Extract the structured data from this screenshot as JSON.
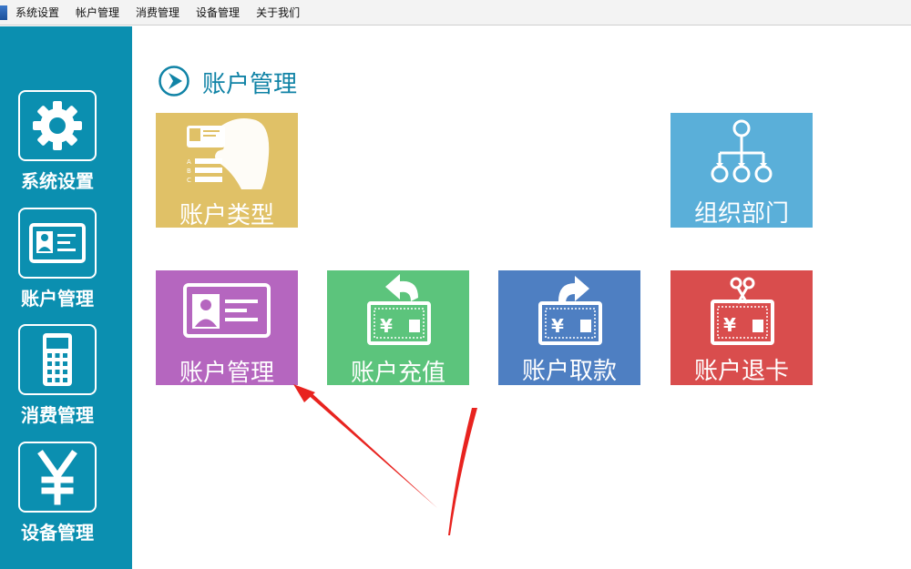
{
  "menubar": {
    "items": [
      "系统设置",
      "帐户管理",
      "消费管理",
      "设备管理",
      "关于我们"
    ]
  },
  "sidebar": {
    "items": [
      {
        "label": "系统设置",
        "icon": "gear-icon"
      },
      {
        "label": "账户管理",
        "icon": "id-card-icon"
      },
      {
        "label": "消费管理",
        "icon": "calculator-icon"
      },
      {
        "label": "设备管理",
        "icon": "yen-icon"
      }
    ]
  },
  "main": {
    "title": "账户管理",
    "tiles": [
      {
        "label": "账户类型",
        "color": "#e0c167",
        "icon": "hand-card-icon"
      },
      {
        "label": "组织部门",
        "color": "#5aafd9",
        "icon": "org-chart-icon"
      },
      {
        "label": "账户管理",
        "color": "#b566bf",
        "icon": "id-card-icon"
      },
      {
        "label": "账户充值",
        "color": "#5cc47c",
        "icon": "recharge-icon"
      },
      {
        "label": "账户取款",
        "color": "#4e7fc2",
        "icon": "withdraw-icon"
      },
      {
        "label": "账户退卡",
        "color": "#d94d4d",
        "icon": "refund-card-icon"
      }
    ]
  },
  "colors": {
    "sidebar": "#0b8fb0",
    "heading": "#1083a6",
    "annotation_arrow": "#e8231f"
  }
}
